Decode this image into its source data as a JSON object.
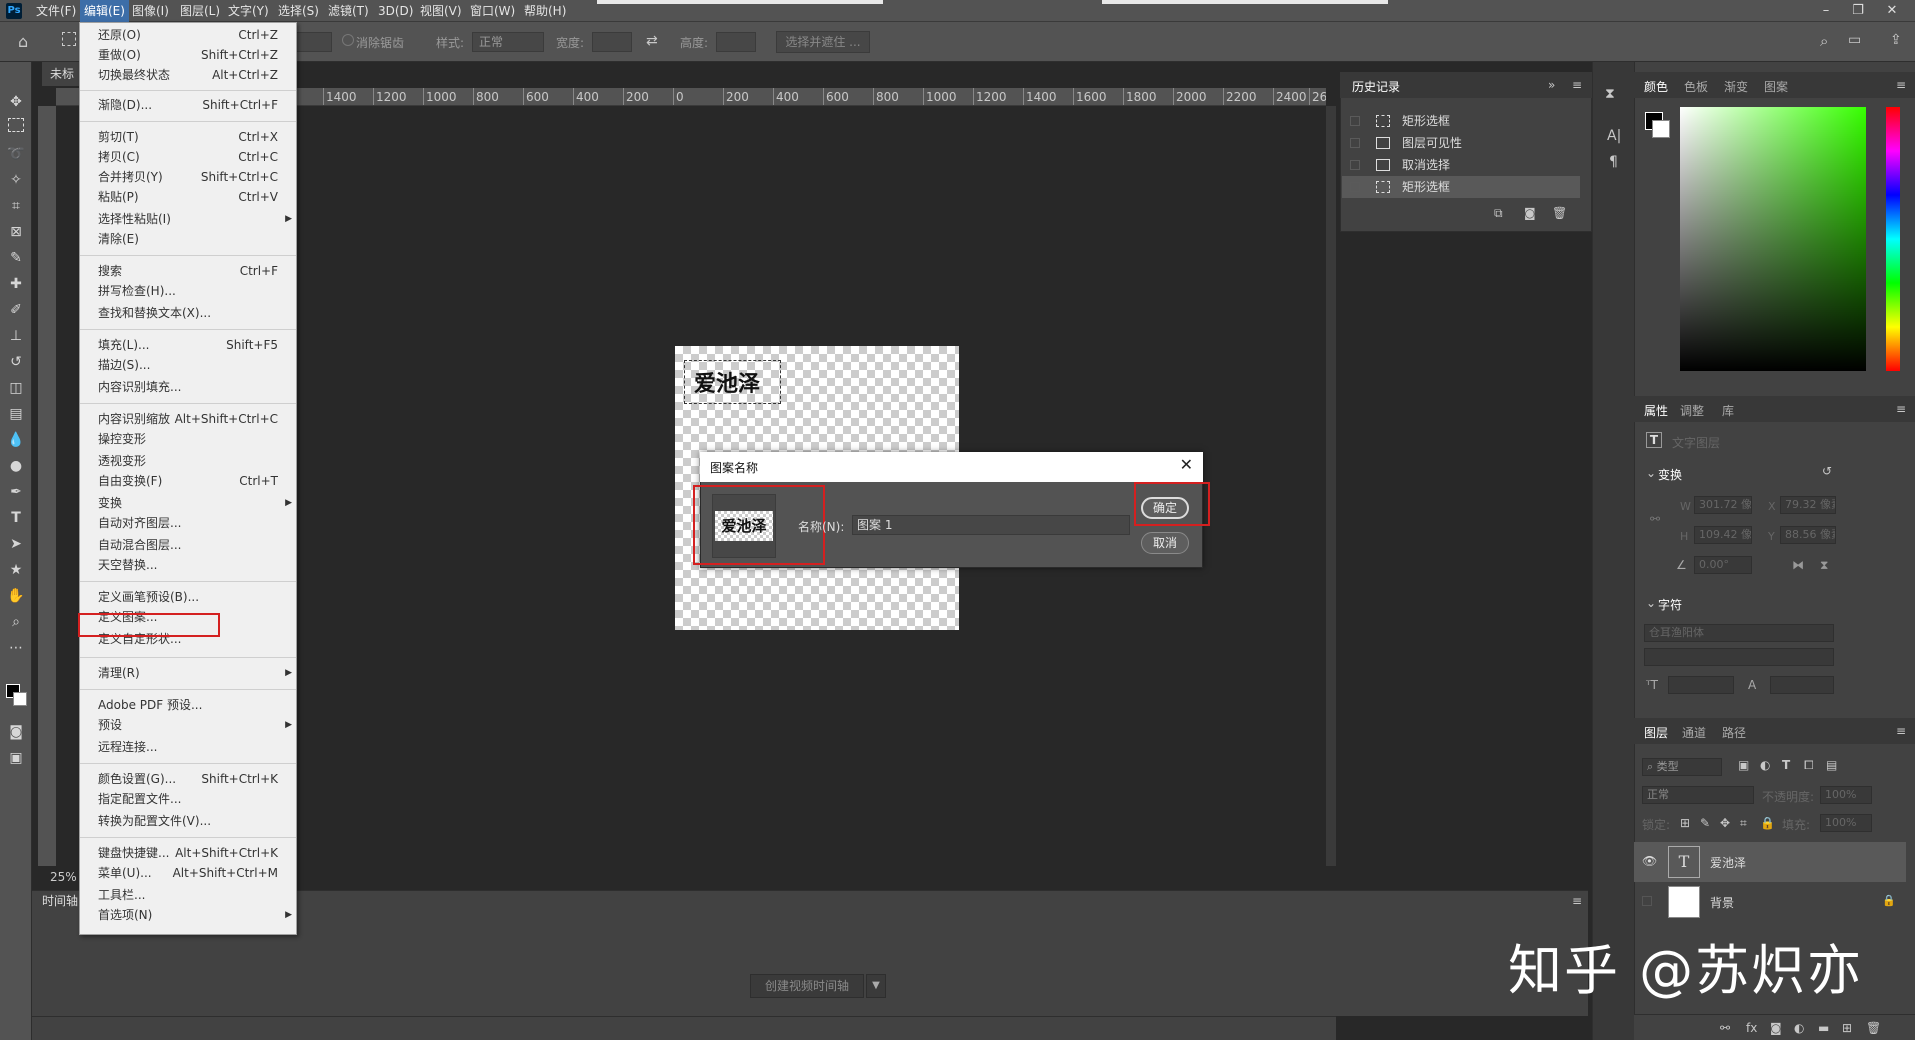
{
  "app": {
    "logo": "Ps"
  },
  "menubar": {
    "items": [
      "文件(F)",
      "编辑(E)",
      "图像(I)",
      "图层(L)",
      "文字(Y)",
      "选择(S)",
      "滤镜(T)",
      "3D(D)",
      "视图(V)",
      "窗口(W)",
      "帮助(H)"
    ],
    "window_controls": [
      "minimize-icon",
      "restore-icon",
      "close-icon"
    ]
  },
  "options_bar": {
    "feather_label": "消除锯齿",
    "style_label": "样式:",
    "style_value": "正常",
    "width_label": "宽度:",
    "height_label": "高度:",
    "select_mask_button": "选择并遮住 ..."
  },
  "document": {
    "tab_title": "未标",
    "zoom": "25%",
    "ruler_ticks": [
      "1400",
      "1200",
      "1000",
      "800",
      "600",
      "400",
      "200",
      "0",
      "200",
      "400",
      "600",
      "800",
      "1000",
      "1200",
      "1400",
      "1600",
      "1800",
      "2000",
      "2200",
      "2400",
      "26"
    ],
    "canvas_text": "爱池泽"
  },
  "edit_menu": {
    "groups": [
      [
        {
          "label": "还原(O)",
          "shortcut": "Ctrl+Z"
        },
        {
          "label": "重做(O)",
          "shortcut": "Shift+Ctrl+Z"
        },
        {
          "label": "切换最终状态",
          "shortcut": "Alt+Ctrl+Z"
        }
      ],
      [
        {
          "label": "渐隐(D)...",
          "shortcut": "Shift+Ctrl+F"
        }
      ],
      [
        {
          "label": "剪切(T)",
          "shortcut": "Ctrl+X"
        },
        {
          "label": "拷贝(C)",
          "shortcut": "Ctrl+C"
        },
        {
          "label": "合并拷贝(Y)",
          "shortcut": "Shift+Ctrl+C"
        },
        {
          "label": "粘贴(P)",
          "shortcut": "Ctrl+V"
        },
        {
          "label": "选择性粘贴(I)",
          "shortcut": "",
          "submenu": true
        },
        {
          "label": "清除(E)",
          "shortcut": ""
        }
      ],
      [
        {
          "label": "搜索",
          "shortcut": "Ctrl+F"
        },
        {
          "label": "拼写检查(H)...",
          "shortcut": ""
        },
        {
          "label": "查找和替换文本(X)...",
          "shortcut": ""
        }
      ],
      [
        {
          "label": "填充(L)...",
          "shortcut": "Shift+F5"
        },
        {
          "label": "描边(S)...",
          "shortcut": ""
        },
        {
          "label": "内容识别填充...",
          "shortcut": ""
        }
      ],
      [
        {
          "label": "内容识别缩放",
          "shortcut": "Alt+Shift+Ctrl+C"
        },
        {
          "label": "操控变形",
          "shortcut": ""
        },
        {
          "label": "透视变形",
          "shortcut": ""
        },
        {
          "label": "自由变换(F)",
          "shortcut": "Ctrl+T"
        },
        {
          "label": "变换",
          "shortcut": "",
          "submenu": true
        },
        {
          "label": "自动对齐图层...",
          "shortcut": ""
        },
        {
          "label": "自动混合图层...",
          "shortcut": ""
        },
        {
          "label": "天空替换...",
          "shortcut": ""
        }
      ],
      [
        {
          "label": "定义画笔预设(B)...",
          "shortcut": ""
        },
        {
          "label": "定义图案...",
          "shortcut": ""
        },
        {
          "label": "定义自定形状...",
          "shortcut": ""
        }
      ],
      [
        {
          "label": "清理(R)",
          "shortcut": "",
          "submenu": true
        }
      ],
      [
        {
          "label": "Adobe PDF 预设...",
          "shortcut": ""
        },
        {
          "label": "预设",
          "shortcut": "",
          "submenu": true
        },
        {
          "label": "远程连接...",
          "shortcut": ""
        }
      ],
      [
        {
          "label": "颜色设置(G)...",
          "shortcut": "Shift+Ctrl+K"
        },
        {
          "label": "指定配置文件...",
          "shortcut": ""
        },
        {
          "label": "转换为配置文件(V)...",
          "shortcut": ""
        }
      ],
      [
        {
          "label": "键盘快捷键...",
          "shortcut": "Alt+Shift+Ctrl+K"
        },
        {
          "label": "菜单(U)...",
          "shortcut": "Alt+Shift+Ctrl+M"
        },
        {
          "label": "工具栏...",
          "shortcut": ""
        },
        {
          "label": "首选项(N)",
          "shortcut": "",
          "submenu": true
        }
      ]
    ]
  },
  "history": {
    "title": "历史记录",
    "items": [
      "矩形选框",
      "图层可见性",
      "取消选择",
      "矩形选框"
    ]
  },
  "color_panel": {
    "tabs": [
      "颜色",
      "色板",
      "渐变",
      "图案"
    ],
    "accent": "#36ff00"
  },
  "properties_panel": {
    "tabs": [
      "属性",
      "调整",
      "库"
    ],
    "layer_type": "文字图层",
    "transform_label": "变换",
    "w": "301.72 像",
    "x": "79.32 像素",
    "h": "109.42 像",
    "y": "88.56 像素",
    "angle": "0.00°",
    "character_label": "字符",
    "font": "仓耳渔阳体"
  },
  "layers_panel": {
    "tabs": [
      "图层",
      "通道",
      "路径"
    ],
    "filter_kind": "类型",
    "blend_mode": "正常",
    "opacity_label": "不透明度:",
    "opacity_value": "100%",
    "lock_label": "锁定:",
    "fill_label": "填充:",
    "fill_value": "100%",
    "layers": [
      {
        "name": "爱池泽",
        "type": "text"
      },
      {
        "name": "背景",
        "type": "background"
      }
    ]
  },
  "timeline": {
    "tab": "时间轴",
    "create_button": "创建视频时间轴"
  },
  "dialog": {
    "title": "图案名称",
    "preview_text": "爱池泽",
    "name_label": "名称(N):",
    "name_value": "图案 1",
    "ok": "确定",
    "cancel": "取消"
  },
  "watermark": "知乎 @苏炽亦"
}
